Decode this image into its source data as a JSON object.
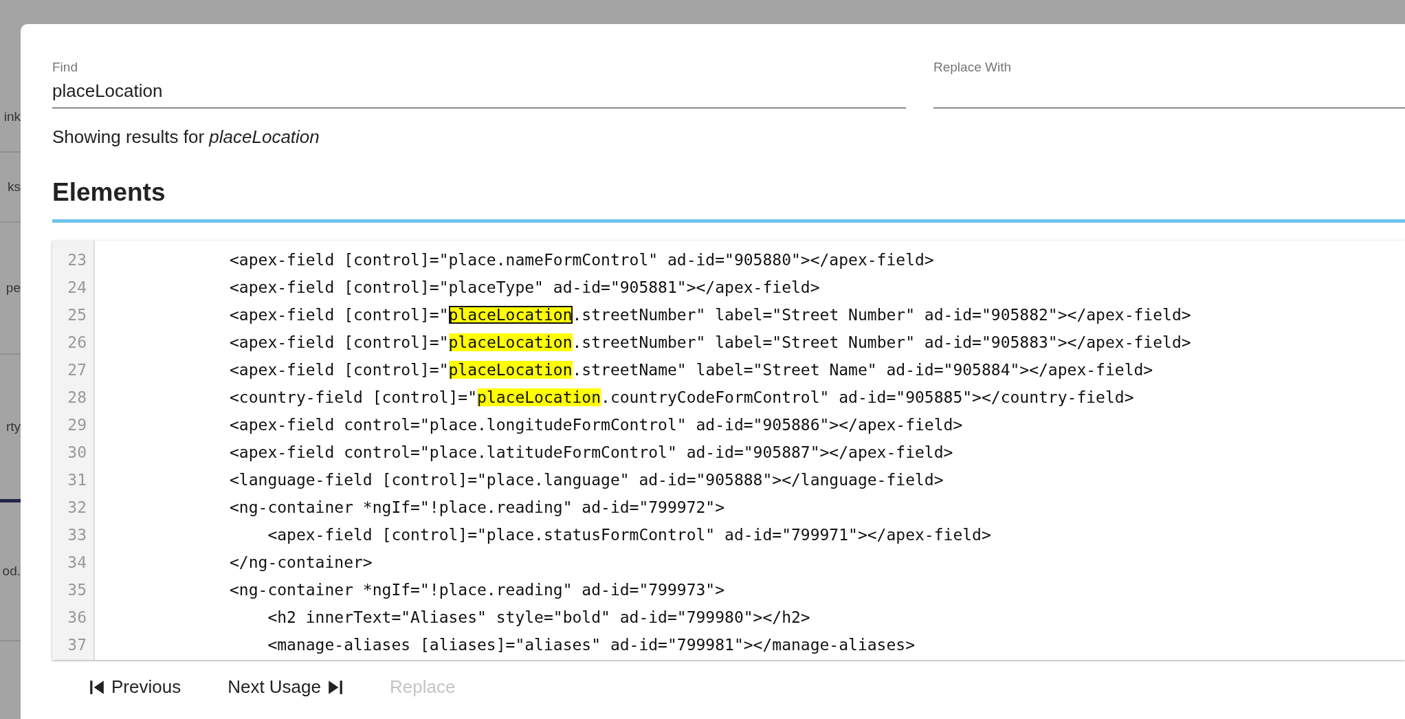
{
  "background_fragments": [
    "ink",
    "ks",
    "pe",
    "rty",
    "od."
  ],
  "find": {
    "label": "Find",
    "value": "placeLocation"
  },
  "replace": {
    "label": "Replace With"
  },
  "results_note": "Showing results for *placeLocation*",
  "section_title": "Elements",
  "code_lines": [
    {
      "number": "23",
      "segments": [
        {
          "kind": "plain",
          "text": "<apex-field [control]=\"place.nameFormControl\" ad-id=\"905880\"></apex-field>"
        }
      ]
    },
    {
      "number": "24",
      "segments": [
        {
          "kind": "plain",
          "text": "<apex-field [control]=\"placeType\" ad-id=\"905881\"></apex-field>"
        }
      ]
    },
    {
      "number": "25",
      "segments": [
        {
          "kind": "plain",
          "text": "<apex-field [control]=\""
        },
        {
          "kind": "match",
          "text": "placeLocation",
          "current": true
        },
        {
          "kind": "plain",
          "text": ".streetNumber\" label=\"Street Number\" ad-id=\"905882\"></apex-field>"
        }
      ]
    },
    {
      "number": "26",
      "segments": [
        {
          "kind": "plain",
          "text": "<apex-field [control]=\""
        },
        {
          "kind": "match",
          "text": "placeLocation",
          "current": false
        },
        {
          "kind": "plain",
          "text": ".streetNumber\" label=\"Street Number\" ad-id=\"905883\"></apex-field>"
        }
      ]
    },
    {
      "number": "27",
      "segments": [
        {
          "kind": "plain",
          "text": "<apex-field [control]=\""
        },
        {
          "kind": "match",
          "text": "placeLocation",
          "current": false
        },
        {
          "kind": "plain",
          "text": ".streetName\" label=\"Street Name\" ad-id=\"905884\"></apex-field>"
        }
      ]
    },
    {
      "number": "28",
      "segments": [
        {
          "kind": "plain",
          "text": "<country-field [control]=\""
        },
        {
          "kind": "match",
          "text": "placeLocation",
          "current": false
        },
        {
          "kind": "plain",
          "text": ".countryCodeFormControl\" ad-id=\"905885\"></country-field>"
        }
      ]
    },
    {
      "number": "29",
      "segments": [
        {
          "kind": "plain",
          "text": "<apex-field control=\"place.longitudeFormControl\" ad-id=\"905886\"></apex-field>"
        }
      ]
    },
    {
      "number": "30",
      "segments": [
        {
          "kind": "plain",
          "text": "<apex-field control=\"place.latitudeFormControl\" ad-id=\"905887\"></apex-field>"
        }
      ]
    },
    {
      "number": "31",
      "segments": [
        {
          "kind": "plain",
          "text": "<language-field [control]=\"place.language\" ad-id=\"905888\"></language-field>"
        }
      ]
    },
    {
      "number": "32",
      "segments": [
        {
          "kind": "plain",
          "text": "<ng-container *ngIf=\"!place.reading\" ad-id=\"799972\">"
        }
      ]
    },
    {
      "number": "33",
      "segments": [
        {
          "kind": "plain",
          "text": "    <apex-field [control]=\"place.statusFormControl\" ad-id=\"799971\"></apex-field>"
        }
      ]
    },
    {
      "number": "34",
      "segments": [
        {
          "kind": "plain",
          "text": "</ng-container>"
        }
      ]
    },
    {
      "number": "35",
      "segments": [
        {
          "kind": "plain",
          "text": "<ng-container *ngIf=\"!place.reading\" ad-id=\"799973\">"
        }
      ]
    },
    {
      "number": "36",
      "segments": [
        {
          "kind": "plain",
          "text": "    <h2 innerText=\"Aliases\" style=\"bold\" ad-id=\"799980\"></h2>"
        }
      ]
    },
    {
      "number": "37",
      "segments": [
        {
          "kind": "plain",
          "text": "    <manage-aliases [aliases]=\"aliases\" ad-id=\"799981\"></manage-aliases>"
        }
      ]
    }
  ],
  "buttons": [
    {
      "kind": "previous",
      "label": "Previous",
      "disabled": false
    },
    {
      "kind": "next",
      "label": "Next Usage",
      "disabled": false
    },
    {
      "kind": "replace",
      "label": "Replace",
      "disabled": true
    }
  ]
}
